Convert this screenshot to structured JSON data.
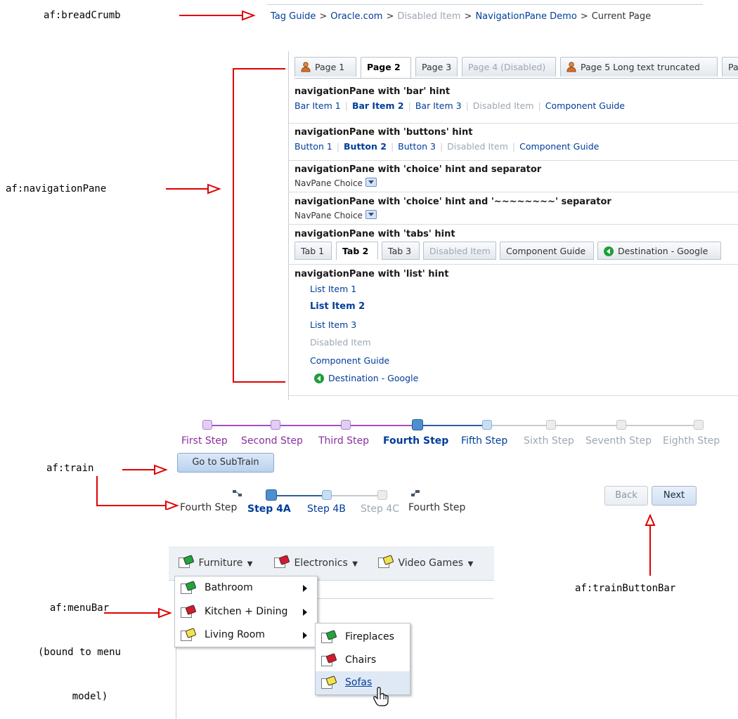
{
  "labels": {
    "breadcrumb": "af:breadCrumb",
    "navpane": "af:navigationPane",
    "train": "af:train",
    "menubar_lines": [
      "af:menuBar",
      "(bound to menu",
      "model)"
    ],
    "trainbuttonbar": "af:trainButtonBar"
  },
  "breadcrumb": {
    "items": [
      "Tag Guide",
      "Oracle.com",
      "Disabled Item",
      "NavigationPane Demo",
      "Current Page"
    ],
    "separator": ">"
  },
  "page_tabs": [
    "Page 1",
    "Page 2",
    "Page 3",
    "Page 4 (Disabled)",
    "Page 5 Long text truncated",
    "Pag"
  ],
  "bar_section": {
    "title": "navigationPane with 'bar' hint",
    "items": [
      "Bar Item 1",
      "Bar Item 2",
      "Bar Item 3",
      "Disabled Item",
      "Component Guide"
    ]
  },
  "buttons_section": {
    "title": "navigationPane with 'buttons' hint",
    "items": [
      "Button 1",
      "Button 2",
      "Button 3",
      "Disabled Item",
      "Component Guide"
    ]
  },
  "choice_section": {
    "title": "navigationPane with 'choice' hint and separator",
    "value": "NavPane Choice"
  },
  "choice2_section": {
    "title": "navigationPane with 'choice' hint and '~~~~~~~~' separator",
    "value": "NavPane Choice"
  },
  "tabs_section": {
    "title": "navigationPane with 'tabs' hint",
    "items": [
      "Tab 1",
      "Tab 2",
      "Tab 3",
      "Disabled Item",
      "Component Guide",
      "Destination - Google"
    ]
  },
  "list_section": {
    "title": "navigationPane with 'list' hint",
    "items": [
      "List Item 1",
      "List Item 2",
      "List Item 3",
      "Disabled Item",
      "Component Guide",
      "Destination - Google"
    ]
  },
  "train": {
    "steps": [
      "First Step",
      "Second Step",
      "Third Step",
      "Fourth Step",
      "Fifth Step",
      "Sixth Step",
      "Seventh Step",
      "Eighth Step"
    ],
    "subtrain_button": "Go to SubTrain",
    "subtrain": [
      "Fourth Step",
      "Step 4A",
      "Step 4B",
      "Step 4C",
      "Fourth Step"
    ]
  },
  "train_buttons": {
    "back": "Back",
    "next": "Next"
  },
  "menubar": {
    "menus": [
      "Furniture",
      "Electronics",
      "Video Games"
    ],
    "submenu": [
      "Bathroom",
      "Kitchen + Dining",
      "Living Room"
    ],
    "subsubmenu": [
      "Fireplaces",
      "Chairs",
      "Sofas"
    ]
  },
  "colors": {
    "link": "#003d99",
    "disabled": "#9da7b3",
    "visited": "#8a2f9e",
    "annotation_arrow": "#e00000"
  }
}
